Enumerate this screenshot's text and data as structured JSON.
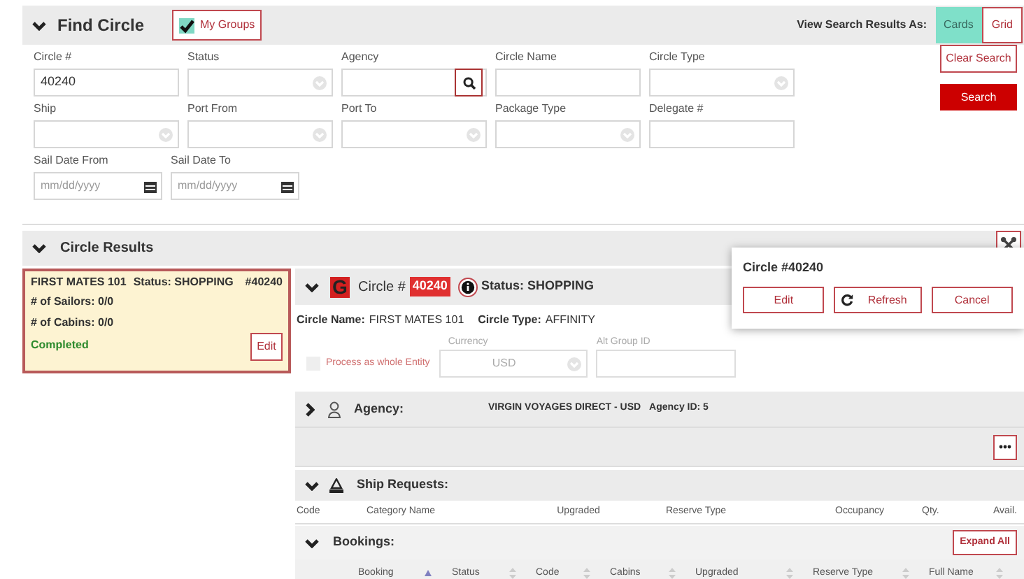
{
  "find_circle": {
    "title": "Find Circle",
    "expanded": true,
    "my_groups": {
      "label": "My Groups",
      "checked": true
    },
    "view_label": "View Search Results As:",
    "view_options": [
      {
        "label": "Cards",
        "selected": true
      },
      {
        "label": "Grid",
        "selected": false
      }
    ]
  },
  "search_rows": [
    [
      {
        "label": "Circle #",
        "kind": "text",
        "value": "40240"
      },
      {
        "label": "Status",
        "kind": "select"
      },
      {
        "label": "Agency",
        "kind": "lookup"
      },
      {
        "label": "Circle Name",
        "kind": "text"
      },
      {
        "label": "Circle Type",
        "kind": "select"
      }
    ],
    [
      {
        "label": "Ship",
        "kind": "select"
      },
      {
        "label": "Port From",
        "kind": "select"
      },
      {
        "label": "Port To",
        "kind": "select"
      },
      {
        "label": "Package Type",
        "kind": "select"
      },
      {
        "label": "Delegate #",
        "kind": "text"
      }
    ],
    [
      {
        "label": "Sail Date From",
        "kind": "date",
        "placeholder": "mm/dd/yyyy"
      },
      {
        "label": "Sail Date To",
        "kind": "date",
        "placeholder": "mm/dd/yyyy"
      }
    ]
  ],
  "search_buttons": {
    "clear": "Clear Search",
    "search": "Search"
  },
  "results": {
    "title": "Circle Results",
    "expanded": true
  },
  "cards": [
    {
      "name": "FIRST MATES 101",
      "status": "Status: SHOPPING",
      "number": "#40240",
      "sailors": "# of Sailors: 0/0",
      "cabins": "# of Cabins: 0/0",
      "state": "Completed",
      "edit": "Edit",
      "selected": true
    }
  ],
  "detail": {
    "expanded": true,
    "logo": "G",
    "circle_label": "Circle #",
    "circle_number": "40240",
    "status": "Status: SHOPPING",
    "circle_name_label": "Circle Name:",
    "circle_name": "FIRST MATES 101",
    "circle_type_label": "Circle Type:",
    "circle_type": "AFFINITY",
    "process": {
      "label": "Process as whole Entity",
      "checked": false
    },
    "currency": {
      "label": "Currency",
      "value": "USD",
      "disabled": true
    },
    "alt_group": {
      "label": "Alt Group ID"
    },
    "agency": {
      "label": "Agency:",
      "expanded": false,
      "value": "VIRGIN VOYAGES DIRECT - USD",
      "id": "Agency ID: 5"
    },
    "ship_requests": {
      "label": "Ship Requests:",
      "expanded": true,
      "columns": [
        "Code",
        "Category Name",
        "Upgraded",
        "Reserve Type",
        "Occupancy",
        "Qty.",
        "Avail."
      ]
    },
    "bookings": {
      "label": "Bookings:",
      "expanded": true,
      "expand_all": "Expand All",
      "columns": [
        {
          "label": "Booking",
          "sorted": true
        },
        {
          "label": "Status",
          "sorted": false
        },
        {
          "label": "Code",
          "sorted": false
        },
        {
          "label": "Cabins",
          "sorted": false
        },
        {
          "label": "Upgraded",
          "sorted": false
        },
        {
          "label": "Reserve Type",
          "sorted": false
        },
        {
          "label": "Full Name",
          "sorted": false
        }
      ]
    }
  },
  "popup": {
    "title": "Circle #40240",
    "buttons": [
      {
        "label": "Edit",
        "kind": "plain"
      },
      {
        "label": "Refresh",
        "kind": "refresh"
      },
      {
        "label": "Cancel",
        "kind": "plain"
      }
    ]
  }
}
